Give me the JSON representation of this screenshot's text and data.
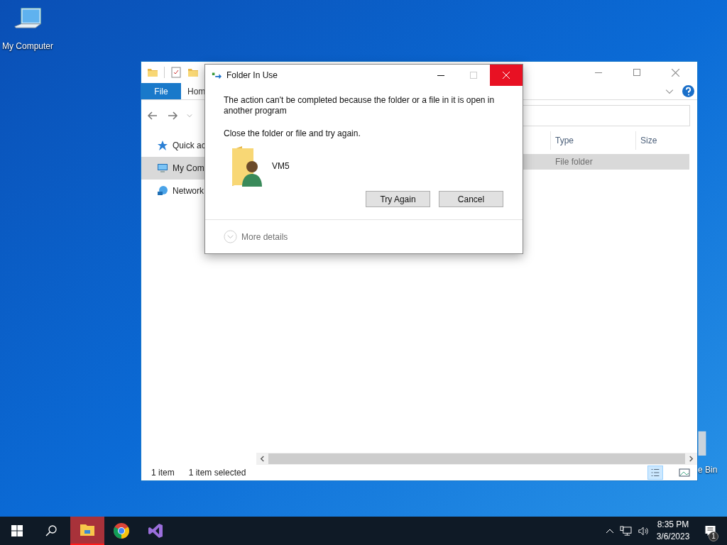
{
  "desktop_icons": [
    {
      "kind": "computer",
      "label": "My Computer"
    },
    {
      "kind": "recycle",
      "label": "e Bin"
    }
  ],
  "explorer": {
    "ribbon_tabs": [
      {
        "kind": "file",
        "label": "File"
      },
      {
        "kind": "tab",
        "label": "Hom"
      }
    ],
    "nav_items": [
      {
        "kind": "star",
        "label": "Quick ac",
        "selected": false
      },
      {
        "kind": "computer",
        "label": "My Com",
        "selected": true
      },
      {
        "kind": "network",
        "label": "Network",
        "selected": false
      }
    ],
    "columns": [
      "Type",
      "Size"
    ],
    "rows": [
      {
        "type": "File folder",
        "selected": true
      }
    ],
    "status": [
      "1 item",
      "1 item selected"
    ]
  },
  "dialog": {
    "title": "Folder In Use",
    "message": "The action can't be completed because the folder or a file in it is open in another program",
    "instruction": "Close the folder or file and try again.",
    "file_name": "VM5",
    "buttons": [
      "Try Again",
      "Cancel"
    ],
    "more_details": "More details"
  },
  "taskbar": {
    "apps": [
      {
        "kind": "explorer",
        "flashing": true
      },
      {
        "kind": "chrome",
        "flashing": false
      },
      {
        "kind": "vs",
        "flashing": false
      }
    ],
    "time": "8:35 PM",
    "date": "3/6/2023",
    "notification_count": "1"
  }
}
